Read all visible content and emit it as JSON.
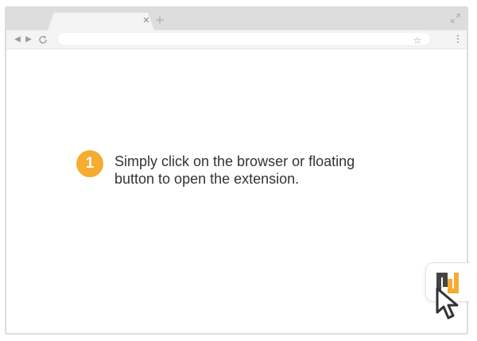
{
  "browser": {
    "tab_close_icon": "close-icon",
    "new_tab_icon": "plus-icon",
    "back_icon": "arrow-left-icon",
    "forward_icon": "arrow-right-icon",
    "reload_icon": "reload-icon",
    "bookmark_icon": "star-icon",
    "menu_icon": "kebab-menu-icon",
    "maximize_icon": "expand-icon",
    "url": ""
  },
  "step": {
    "number": "1",
    "text_line1": "Simply click on the browser or floating",
    "text_line2": "button to open the extension.",
    "badge_color": "#f5ac31"
  },
  "floating_button": {
    "logo_icon": "extension-logo-icon",
    "cursor_icon": "mouse-pointer-icon",
    "logo_colors": [
      "#444444",
      "#f5ac31"
    ]
  }
}
